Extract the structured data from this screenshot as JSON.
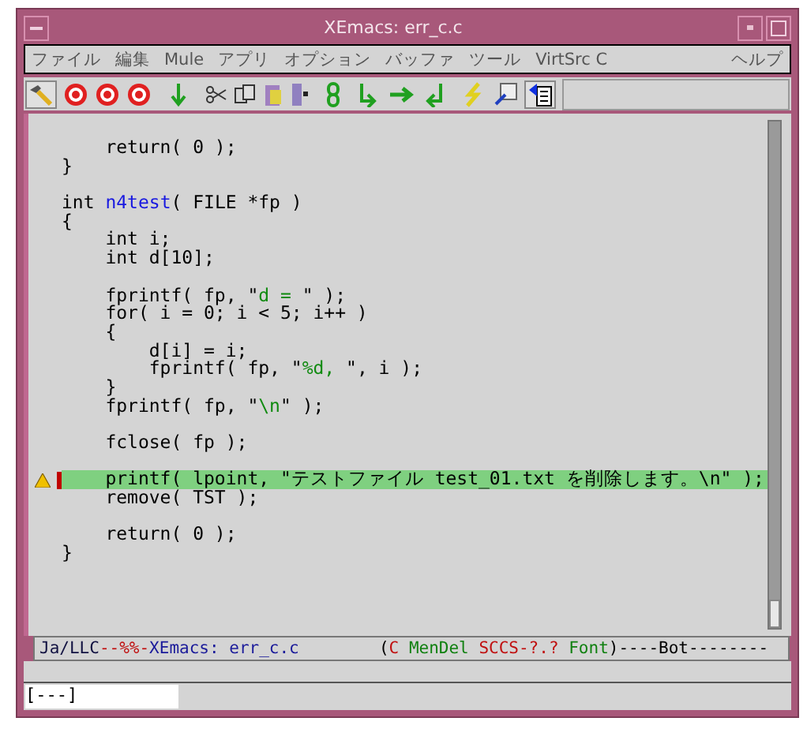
{
  "window": {
    "title": "XEmacs: err_c.c"
  },
  "menubar": {
    "items": [
      "ファイル",
      "編集",
      "Mule",
      "アプリ",
      "オプション",
      "バッファ",
      "ツール",
      "VirtSrc C"
    ],
    "help": "ヘルプ"
  },
  "editor": {
    "lines": [
      {
        "marker": false,
        "highlight": false,
        "segments": [
          {
            "kind": "plain",
            "text": "    return( 0 );"
          }
        ]
      },
      {
        "marker": false,
        "highlight": false,
        "segments": [
          {
            "kind": "plain",
            "text": "}"
          }
        ]
      },
      {
        "marker": false,
        "highlight": false
      },
      {
        "marker": false,
        "highlight": false,
        "segments": [
          {
            "kind": "plain",
            "text": "int "
          },
          {
            "kind": "function",
            "text": "n4test"
          },
          {
            "kind": "plain",
            "text": "( FILE *fp )"
          }
        ]
      },
      {
        "marker": false,
        "highlight": false,
        "segments": [
          {
            "kind": "plain",
            "text": "{"
          }
        ]
      },
      {
        "marker": false,
        "highlight": false,
        "segments": [
          {
            "kind": "plain",
            "text": "    int i;"
          }
        ]
      },
      {
        "marker": false,
        "highlight": false,
        "segments": [
          {
            "kind": "plain",
            "text": "    int d[10];"
          }
        ]
      },
      {
        "marker": false,
        "highlight": false
      },
      {
        "marker": false,
        "highlight": false,
        "segments": [
          {
            "kind": "plain",
            "text": "    fprintf( fp, \""
          },
          {
            "kind": "string",
            "text": "d = "
          },
          {
            "kind": "plain",
            "text": "\" );"
          }
        ]
      },
      {
        "marker": false,
        "highlight": false,
        "segments": [
          {
            "kind": "plain",
            "text": "    for( i = 0; i < 5; i++ )"
          }
        ]
      },
      {
        "marker": false,
        "highlight": false,
        "segments": [
          {
            "kind": "plain",
            "text": "    {"
          }
        ]
      },
      {
        "marker": false,
        "highlight": false,
        "segments": [
          {
            "kind": "plain",
            "text": "        d[i] = i;"
          }
        ]
      },
      {
        "marker": false,
        "highlight": false,
        "segments": [
          {
            "kind": "plain",
            "text": "        fprintf( fp, \""
          },
          {
            "kind": "string",
            "text": "%d, "
          },
          {
            "kind": "plain",
            "text": "\", i );"
          }
        ]
      },
      {
        "marker": false,
        "highlight": false,
        "segments": [
          {
            "kind": "plain",
            "text": "    }"
          }
        ]
      },
      {
        "marker": false,
        "highlight": false,
        "segments": [
          {
            "kind": "plain",
            "text": "    fprintf( fp, \""
          },
          {
            "kind": "string",
            "text": "\\n"
          },
          {
            "kind": "plain",
            "text": "\" );"
          }
        ]
      },
      {
        "marker": false,
        "highlight": false
      },
      {
        "marker": false,
        "highlight": false,
        "segments": [
          {
            "kind": "plain",
            "text": "    fclose( fp );"
          }
        ]
      },
      {
        "marker": false,
        "highlight": false
      },
      {
        "marker": true,
        "highlight": true,
        "segments": [
          {
            "kind": "plain",
            "text": "    printf( lpoint, \"テストファイル test_01.txt を削除します。\\n\" );"
          }
        ]
      },
      {
        "marker": false,
        "highlight": false,
        "segments": [
          {
            "kind": "plain",
            "text": "    remove( TST );"
          }
        ]
      },
      {
        "marker": false,
        "highlight": false
      },
      {
        "marker": false,
        "highlight": false,
        "segments": [
          {
            "kind": "plain",
            "text": "    return( 0 );"
          }
        ]
      },
      {
        "marker": false,
        "highlight": false,
        "segments": [
          {
            "kind": "plain",
            "text": "}"
          }
        ]
      }
    ]
  },
  "status_bar": {
    "segments": [
      {
        "text": "Ja/LLC",
        "color": "#101040"
      },
      {
        "text": "--%%-",
        "color": "#c01010"
      },
      {
        "text": "XEmacs: err_c.c",
        "color": "#1a1a9a"
      },
      {
        "text": "        (",
        "color": "#000000"
      },
      {
        "text": "C ",
        "color": "#c01010"
      },
      {
        "text": "MenDel ",
        "color": "#108010"
      },
      {
        "text": "SCCS-?.? ",
        "color": "#c01010"
      },
      {
        "text": "Font",
        "color": "#108010"
      },
      {
        "text": ")----Bot--------",
        "color": "#000000"
      }
    ]
  },
  "minibuffer": {
    "value": "[---]"
  }
}
